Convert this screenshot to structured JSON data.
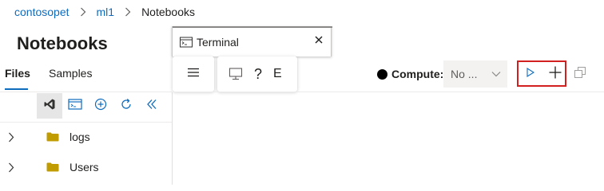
{
  "breadcrumb": {
    "items": [
      {
        "label": "contosopet"
      },
      {
        "label": "ml1"
      }
    ],
    "current": "Notebooks"
  },
  "page": {
    "title": "Notebooks"
  },
  "left_tabs": [
    {
      "label": "Files",
      "active": true
    },
    {
      "label": "Samples",
      "active": false
    }
  ],
  "file_toolbar": {
    "icons": [
      "vscode-icon",
      "terminal-icon",
      "add-circle-icon",
      "refresh-icon",
      "collapse-icon"
    ]
  },
  "tree": [
    {
      "name": "logs",
      "type": "folder"
    },
    {
      "name": "Users",
      "type": "folder"
    }
  ],
  "terminal_tab": {
    "label": "Terminal",
    "icon": "terminal-icon",
    "close_icon": "close-icon"
  },
  "menu": {
    "hamburger_icon": "hamburger-icon",
    "items_icons": [
      "monitor-icon",
      "help-icon"
    ],
    "help_glyph": "?",
    "truncated_text": "E"
  },
  "compute": {
    "status_color": "#000000",
    "label": "Compute:",
    "value": "No ..."
  },
  "actions": {
    "run_icon": "run-icon",
    "add_icon": "plus-icon",
    "split_icon": "split-terminal-icon",
    "highlight_color": "#d21f1f"
  },
  "colors": {
    "accent": "#0f6cbd",
    "folder": "#c19c00"
  }
}
